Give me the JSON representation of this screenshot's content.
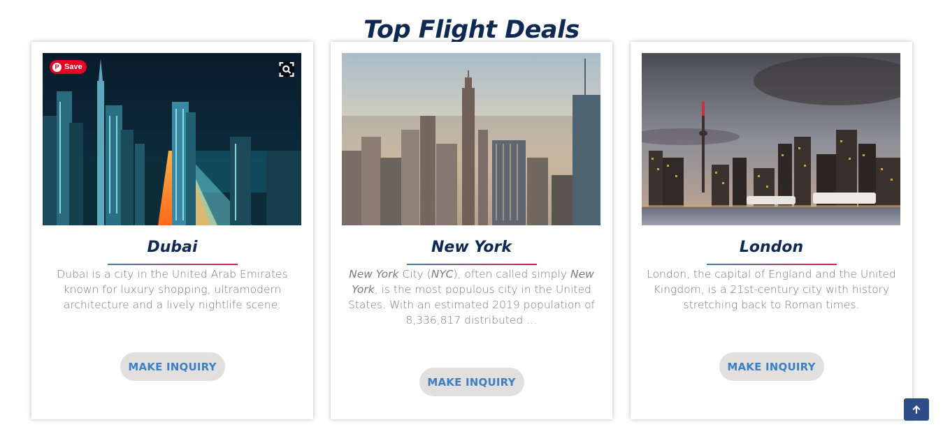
{
  "page": {
    "title": "Top Flight Deals"
  },
  "overlay": {
    "pin_save_label": "Save",
    "pin_logo": "P"
  },
  "cards": [
    {
      "city": "Dubai",
      "description_parts": [
        "Dubai is a city in the United Arab Emirates known for luxury shopping, ultramodern architecture and a lively nightlife scene."
      ],
      "button_label": "MAKE INQUIRY",
      "image": "dubai-night-skyline"
    },
    {
      "city": "New York",
      "description_parts": [
        "New York",
        " City (",
        "NYC",
        "), often called simply ",
        "New York",
        ", is the most populous city in the United States. With an estimated 2019 population of 8,336,817 distributed …"
      ],
      "button_label": "MAKE INQUIRY",
      "image": "new-york-skyline"
    },
    {
      "city": "London",
      "description_parts": [
        "London, the capital of England and the United Kingdom, is a 21st-century city with history stretching back to Roman times."
      ],
      "button_label": "MAKE INQUIRY",
      "image": "waterfront-skyline-dusk"
    }
  ],
  "icons": {
    "lens": "lens-icon",
    "scroll_top": "arrow-up-icon"
  },
  "colors": {
    "title": "#0f2a52",
    "button_text": "#3d7fc0",
    "button_bg": "#e2dfdf",
    "scroll_top_bg": "#2f4e87",
    "pinterest": "#e60023"
  }
}
